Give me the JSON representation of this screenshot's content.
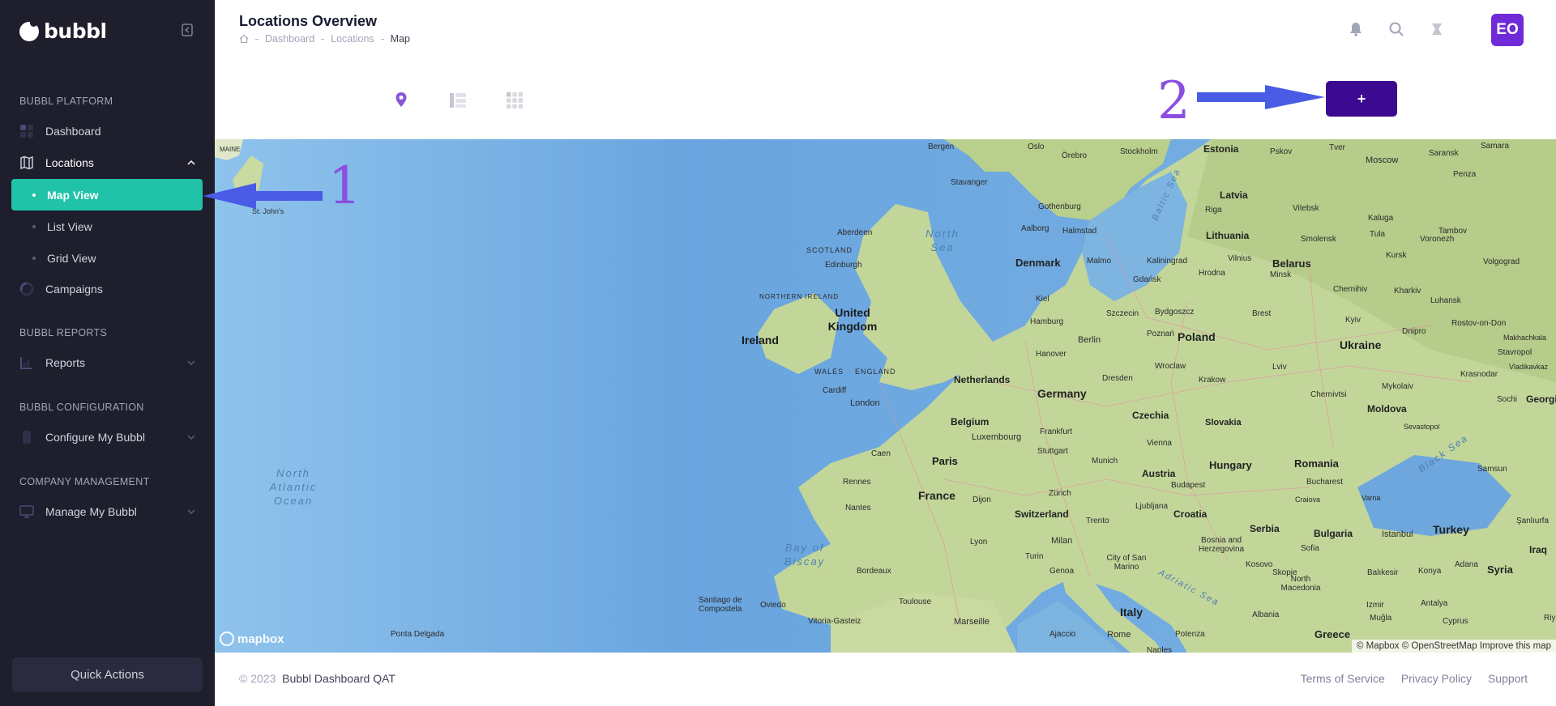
{
  "brand": {
    "name": "bubbl"
  },
  "sidebar": {
    "sections": [
      {
        "label": "BUBBL PLATFORM"
      },
      {
        "label": "BUBBL REPORTS"
      },
      {
        "label": "BUBBL CONFIGURATION"
      },
      {
        "label": "COMPANY MANAGEMENT"
      }
    ],
    "items": {
      "dashboard": "Dashboard",
      "locations": "Locations",
      "map_view": "Map View",
      "list_view": "List View",
      "grid_view": "Grid View",
      "campaigns": "Campaigns",
      "reports": "Reports",
      "configure": "Configure My Bubbl",
      "manage": "Manage My Bubbl"
    },
    "quick_actions": "Quick Actions"
  },
  "header": {
    "title": "Locations Overview",
    "breadcrumb": [
      "Dashboard",
      "Locations",
      "Map"
    ],
    "avatar_initials": "EO"
  },
  "toolbar": {
    "add_label": "+"
  },
  "annotations": {
    "one": "1",
    "two": "2"
  },
  "map": {
    "labels": {
      "bergen": "Bergen",
      "oslo": "Oslo",
      "orebro": "Örebro",
      "stockholm": "Stockholm",
      "estonia": "Estonia",
      "pskov": "Pskov",
      "tver": "Tver",
      "moscow": "Moscow",
      "saransk": "Saransk",
      "samara": "Samara",
      "stavanger": "Stavanger",
      "latvia": "Latvia",
      "gothenburg": "Gothenburg",
      "riga": "Riga",
      "vitebsk": "Vitebsk",
      "penza": "Penza",
      "aberdeen": "Aberdeen",
      "aalborg": "Aalborg",
      "halmstad": "Halmstad",
      "lithuania": "Lithuania",
      "smolensk": "Smolensk",
      "kaluga": "Kaluga",
      "tula": "Tula",
      "tambov": "Tambov",
      "scotland": "SCOTLAND",
      "edinburgh": "Edinburgh",
      "denmark": "Denmark",
      "malmo": "Malmo",
      "kaliningrad": "Kaliningrad",
      "vilnius": "Vilnius",
      "belarus": "Belarus",
      "voronezh": "Voronezh",
      "volgograd": "Volgograd",
      "north_ireland": "NORTHERN IRELAND",
      "ireland": "Ireland",
      "united_kingdom": "United Kingdom",
      "kiel": "Kiel",
      "gdansk": "Gdańsk",
      "hrodna": "Hrodna",
      "minsk": "Minsk",
      "kursk": "Kursk",
      "hamburg": "Hamburg",
      "szczecin": "Szczecin",
      "bydgoszcz": "Bydgoszcz",
      "poland": "Poland",
      "brest": "Brest",
      "chernihiv": "Chernihiv",
      "kharkiv": "Kharkiv",
      "luhansk": "Luhansk",
      "berlin": "Berlin",
      "poznan": "Poznań",
      "kyiv": "Kyiv",
      "ukraine": "Ukraine",
      "dnipro": "Dnipro",
      "rostov": "Rostov-on-Don",
      "wales": "WALES",
      "england": "ENGLAND",
      "netherlands": "Netherlands",
      "hanover": "Hanover",
      "wroclaw": "Wroclaw",
      "lviv": "Lviv",
      "stavropol": "Stavropol",
      "makhachkala": "Makhachkala",
      "cardiff": "Cardiff",
      "london": "London",
      "dresden": "Dresden",
      "krakow": "Krakow",
      "mykolaiv": "Mykolaiv",
      "krasnodar": "Krasnodar",
      "vladikavkaz": "Vladikavkaz",
      "germany": "Germany",
      "chernivtsi": "Chernivtsi",
      "moldova": "Moldova",
      "sochi": "Sochi",
      "georgia": "Georgia",
      "belgium": "Belgium",
      "luxembourg": "Luxembourg",
      "frankfurt": "Frankfurt",
      "czechia": "Czechia",
      "slovakia": "Slovakia",
      "sevastopol": "Sevastopol",
      "caen": "Caen",
      "paris": "Paris",
      "stuttgart": "Stuttgart",
      "munich": "Munich",
      "vienna": "Vienna",
      "hungary": "Hungary",
      "romania": "Romania",
      "samsun": "Samsun",
      "rennes": "Rennes",
      "austria": "Austria",
      "bucharest": "Bucharest",
      "france": "France",
      "dijon": "Dijon",
      "zurich": "Zürich",
      "budapest": "Budapest",
      "craiova": "Craiova",
      "varna": "Varna",
      "nantes": "Nantes",
      "switzerland": "Switzerland",
      "trento": "Trento",
      "ljubljana": "Ljubljana",
      "croatia": "Croatia",
      "serbia": "Serbia",
      "bulgaria": "Bulgaria",
      "turkey": "Turkey",
      "sanliurfa": "Şanlıurfa",
      "lyon": "Lyon",
      "milan": "Milan",
      "bosnia": "Bosnia and Herzegovina",
      "sofia": "Sofia",
      "istanbul": "Istanbul",
      "iraq": "Iraq",
      "turin": "Turin",
      "city_san_marino": "City of San Marino",
      "kosovo": "Kosovo",
      "skopje": "Skopje",
      "syria": "Syria",
      "bordeaux": "Bordeaux",
      "genoa": "Genoa",
      "north_macedonia": "North Macedonia",
      "balikesir": "Balıkesir",
      "konya": "Konya",
      "adana": "Adana",
      "toulouse": "Toulouse",
      "marseille": "Marseille",
      "italy": "Italy",
      "albania": "Albania",
      "izmir": "Izmir",
      "antalya": "Antalya",
      "santiago": "Santiago de Compostela",
      "oviedo": "Oviedo",
      "vitoria": "Vitoria-Gasteiz",
      "mugla": "Muğla",
      "cyprus": "Cyprus",
      "ponta_delgada": "Ponta Delgada",
      "ajaccio": "Ajaccio",
      "rome": "Rome",
      "potenza": "Potenza",
      "greece": "Greece",
      "riyad": "Riyad",
      "naples": "Naples",
      "st_johns": "St. John's",
      "maine": "MAINE",
      "north_sea": "North Sea",
      "baltic_sea": "Baltic Sea",
      "north_atlantic": "North Atlantic Ocean",
      "bay_biscay": "Bay of Biscay",
      "black_sea": "Black Sea",
      "adriatic": "Adriatic Sea"
    },
    "logo": "mapbox",
    "attribution": "© Mapbox © OpenStreetMap Improve this map"
  },
  "footer": {
    "year": "© 2023",
    "company": "Bubbl Dashboard QAT",
    "links": [
      "Terms of Service",
      "Privacy Policy",
      "Support"
    ]
  }
}
